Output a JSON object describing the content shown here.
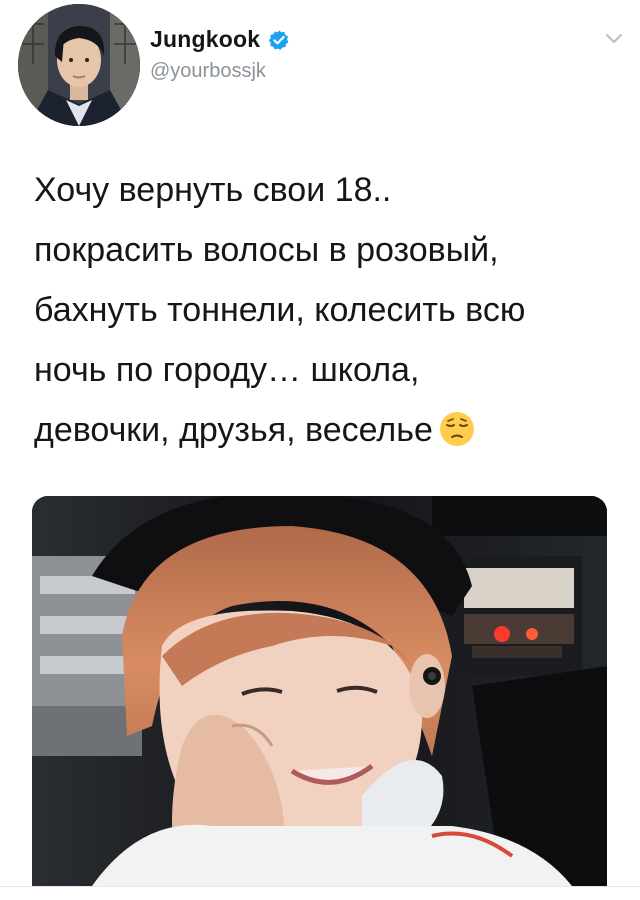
{
  "author": {
    "display_name": "Jungkook",
    "handle": "@yourbossjk",
    "verified": true
  },
  "tweet": {
    "lines": [
      "Хочу  вернуть свои 18..",
      "покрасить волосы в розовый,",
      "бахнуть тоннели, колесить всю",
      "ночь по городу… школа,",
      "девочки, друзья, веселье"
    ],
    "emoji": "pensive-face"
  },
  "icons": {
    "verified": "verified-badge-icon",
    "menu": "chevron-down-icon"
  },
  "colors": {
    "verified_blue": "#1da1f2",
    "text": "#14171a",
    "secondary_text": "#8b9399"
  }
}
